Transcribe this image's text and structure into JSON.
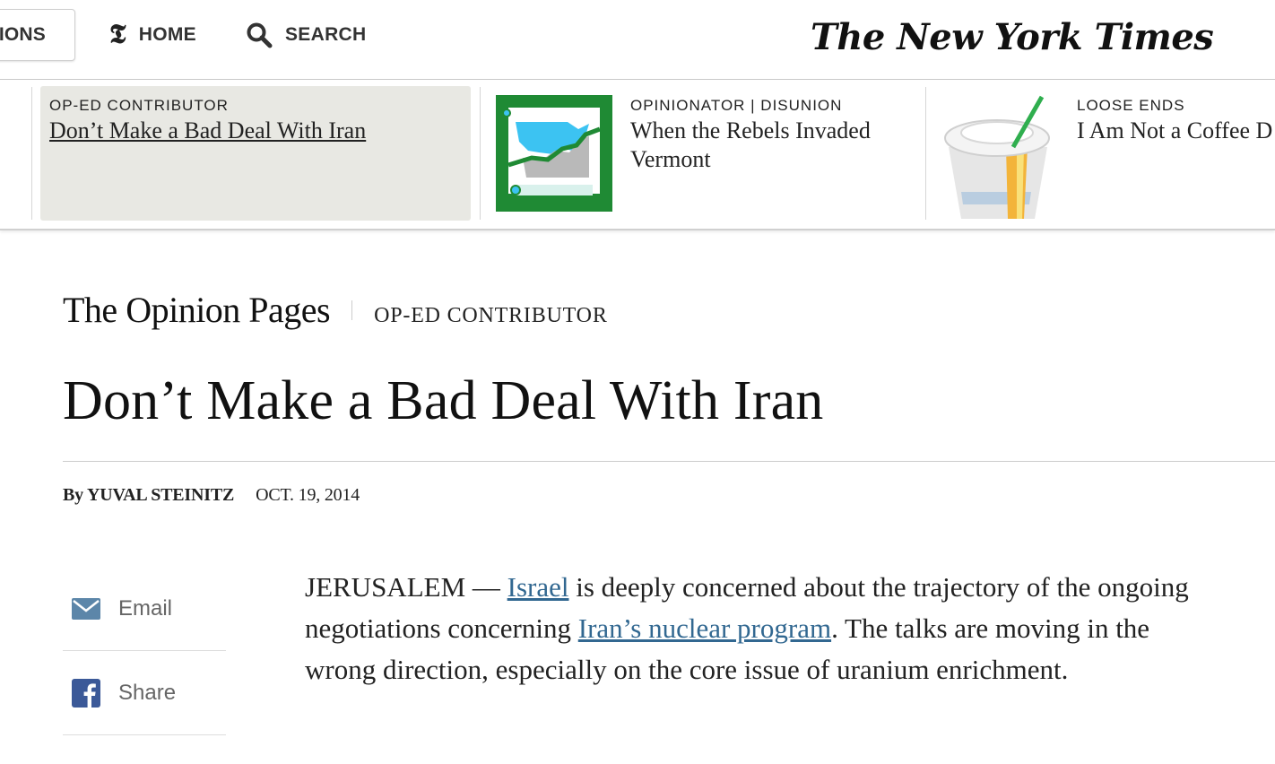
{
  "topbar": {
    "sections_label": "SECTIONS",
    "home_label": "HOME",
    "search_label": "SEARCH",
    "masthead": "The New York Times"
  },
  "ribbon": {
    "items": [
      {
        "kicker": "OP-ED CONTRIBUTOR",
        "headline": "Don’t Make a Bad Deal With Iran"
      },
      {
        "kicker": "OPINIONATOR | DISUNION",
        "headline": "When the Rebels Invaded Vermont"
      },
      {
        "kicker": "LOOSE ENDS",
        "headline": "I Am Not a Coffee D"
      }
    ]
  },
  "article": {
    "section": "The Opinion Pages",
    "kicker": "OP-ED CONTRIBUTOR",
    "headline": "Don’t Make a Bad Deal With Iran",
    "byline": "By YUVAL STEINITZ",
    "date": "OCT. 19, 2014",
    "body": {
      "lead": "JERUSALEM — ",
      "link1": "Israel",
      "text1": " is deeply concerned about the trajectory of the ongoing negotiations concerning ",
      "link2": "Iran’s nuclear program",
      "text2": ". The talks are moving in the wrong direction, especially on the core issue of uranium enrichment."
    }
  },
  "share": {
    "email_label": "Email",
    "share_label": "Share"
  },
  "colors": {
    "link": "#326891",
    "ribbon_active_bg": "#e8e8e3",
    "thumb_green": "#1f8a34",
    "facebook": "#3b5998",
    "email_icon": "#5c86a9"
  }
}
